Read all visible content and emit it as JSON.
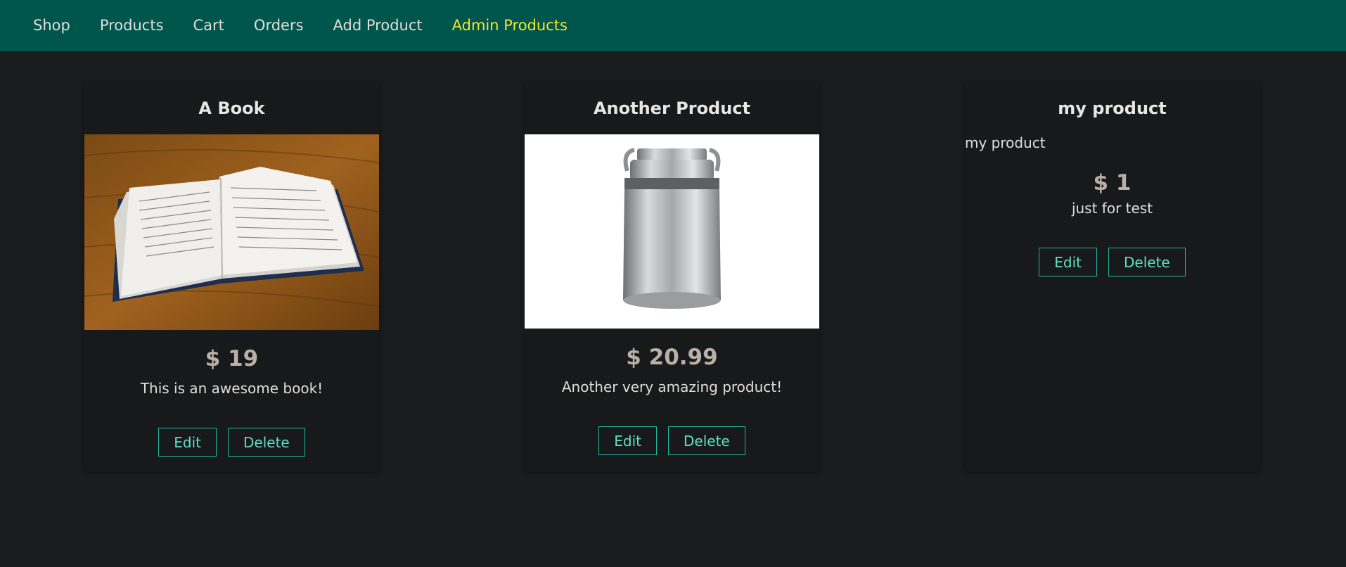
{
  "nav": {
    "items": [
      {
        "label": "Shop"
      },
      {
        "label": "Products"
      },
      {
        "label": "Cart"
      },
      {
        "label": "Orders"
      },
      {
        "label": "Add Product"
      },
      {
        "label": "Admin Products"
      }
    ],
    "active_index": 5,
    "active_color": "#f2e52f",
    "bar_color": "#00564d"
  },
  "products": [
    {
      "title": "A Book",
      "image_subject": "open-book-on-wooden-table",
      "price": "$ 19",
      "description": "This is an awesome book!",
      "edit_label": "Edit",
      "delete_label": "Delete"
    },
    {
      "title": "Another Product",
      "image_subject": "metal-milk-can",
      "price": "$ 20.99",
      "description": "Another very amazing product!",
      "edit_label": "Edit",
      "delete_label": "Delete"
    },
    {
      "title": "my product",
      "image_alt_text": "my product",
      "price": "$ 1",
      "description": "just for test",
      "edit_label": "Edit",
      "delete_label": "Delete"
    }
  ],
  "colors": {
    "background": "#1a1c1e",
    "button_border": "#1fb89f",
    "button_text": "#5ee0c8",
    "price_text": "#b7b0a6"
  }
}
